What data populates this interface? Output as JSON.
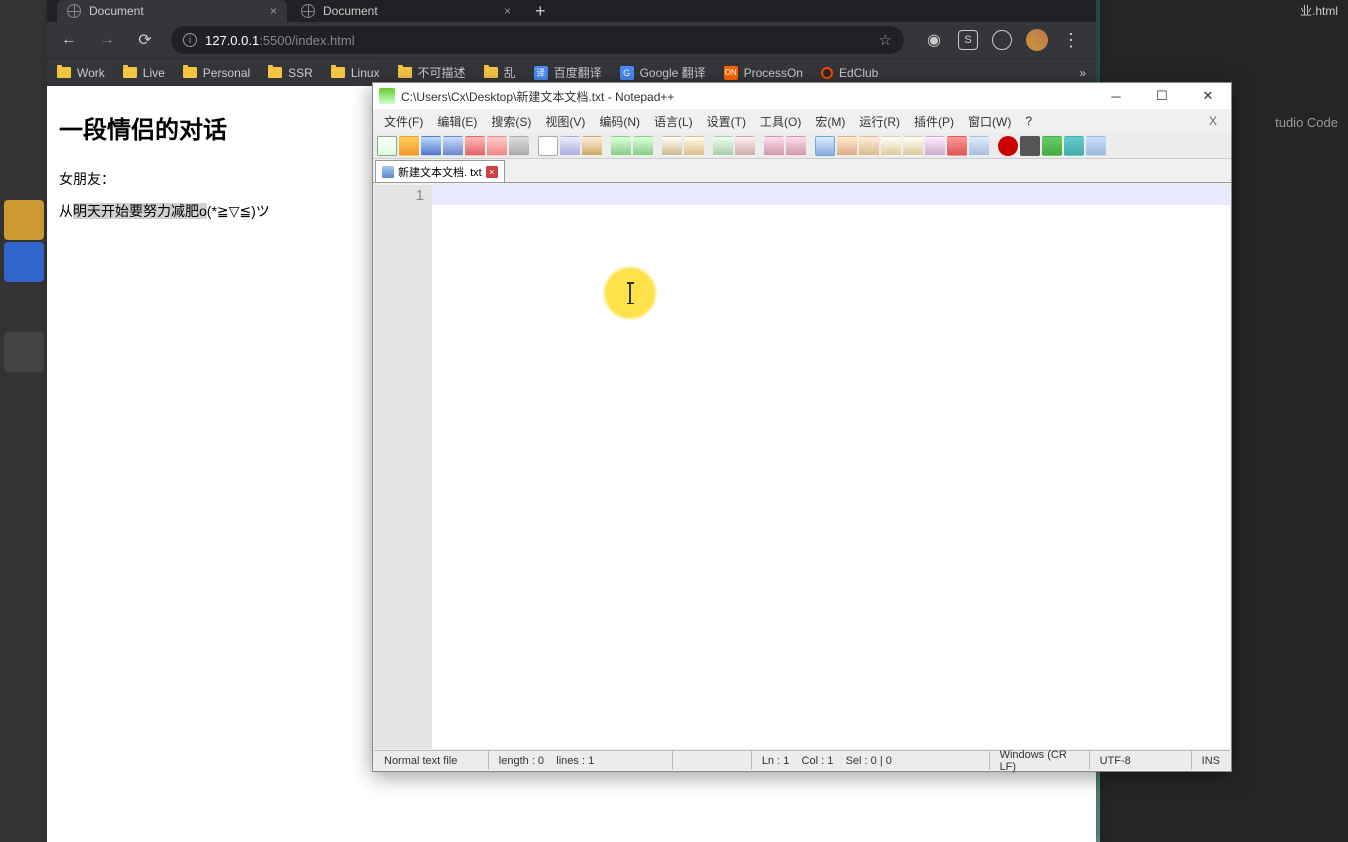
{
  "vscode": {
    "title": "tudio Code",
    "topright": "业.html"
  },
  "browser": {
    "tabs": [
      {
        "title": "Document",
        "active": true
      },
      {
        "title": "Document",
        "active": false
      }
    ],
    "url_main": "127.0.0.1",
    "url_path": ":5500/index.html",
    "bookmarks": [
      {
        "label": "Work",
        "type": "folder"
      },
      {
        "label": "Live",
        "type": "folder"
      },
      {
        "label": "Personal",
        "type": "folder"
      },
      {
        "label": "SSR",
        "type": "folder"
      },
      {
        "label": "Linux",
        "type": "folder"
      },
      {
        "label": "不可描述",
        "type": "folder"
      },
      {
        "label": "乱",
        "type": "folder"
      },
      {
        "label": "百度翻译",
        "type": "blue",
        "badge": "译"
      },
      {
        "label": "Google 翻译",
        "type": "blue",
        "badge": "G"
      },
      {
        "label": "ProcessOn",
        "type": "orange",
        "badge": "ON"
      },
      {
        "label": "EdClub",
        "type": "reddit"
      }
    ]
  },
  "page": {
    "title": "一段情侣的对话",
    "line1": "女朋友：",
    "line2_pre": "从",
    "line2_sel": "明天开始要努力减肥o",
    "line2_post": "(*≧▽≦)ツ"
  },
  "npp": {
    "title": "C:\\Users\\Cx\\Desktop\\新建文本文档.txt - Notepad++",
    "menu": [
      "文件(F)",
      "编辑(E)",
      "搜索(S)",
      "视图(V)",
      "编码(N)",
      "语言(L)",
      "设置(T)",
      "工具(O)",
      "宏(M)",
      "运行(R)",
      "插件(P)",
      "窗口(W)",
      "?"
    ],
    "tab_name": "新建文本文档. txt",
    "gutter": "1",
    "status": {
      "type": "Normal text file",
      "length": "length : 0    lines : 1",
      "pos": "Ln : 1    Col : 1    Sel : 0 | 0",
      "eol": "Windows (CR LF)",
      "enc": "UTF-8",
      "mode": "INS"
    }
  }
}
